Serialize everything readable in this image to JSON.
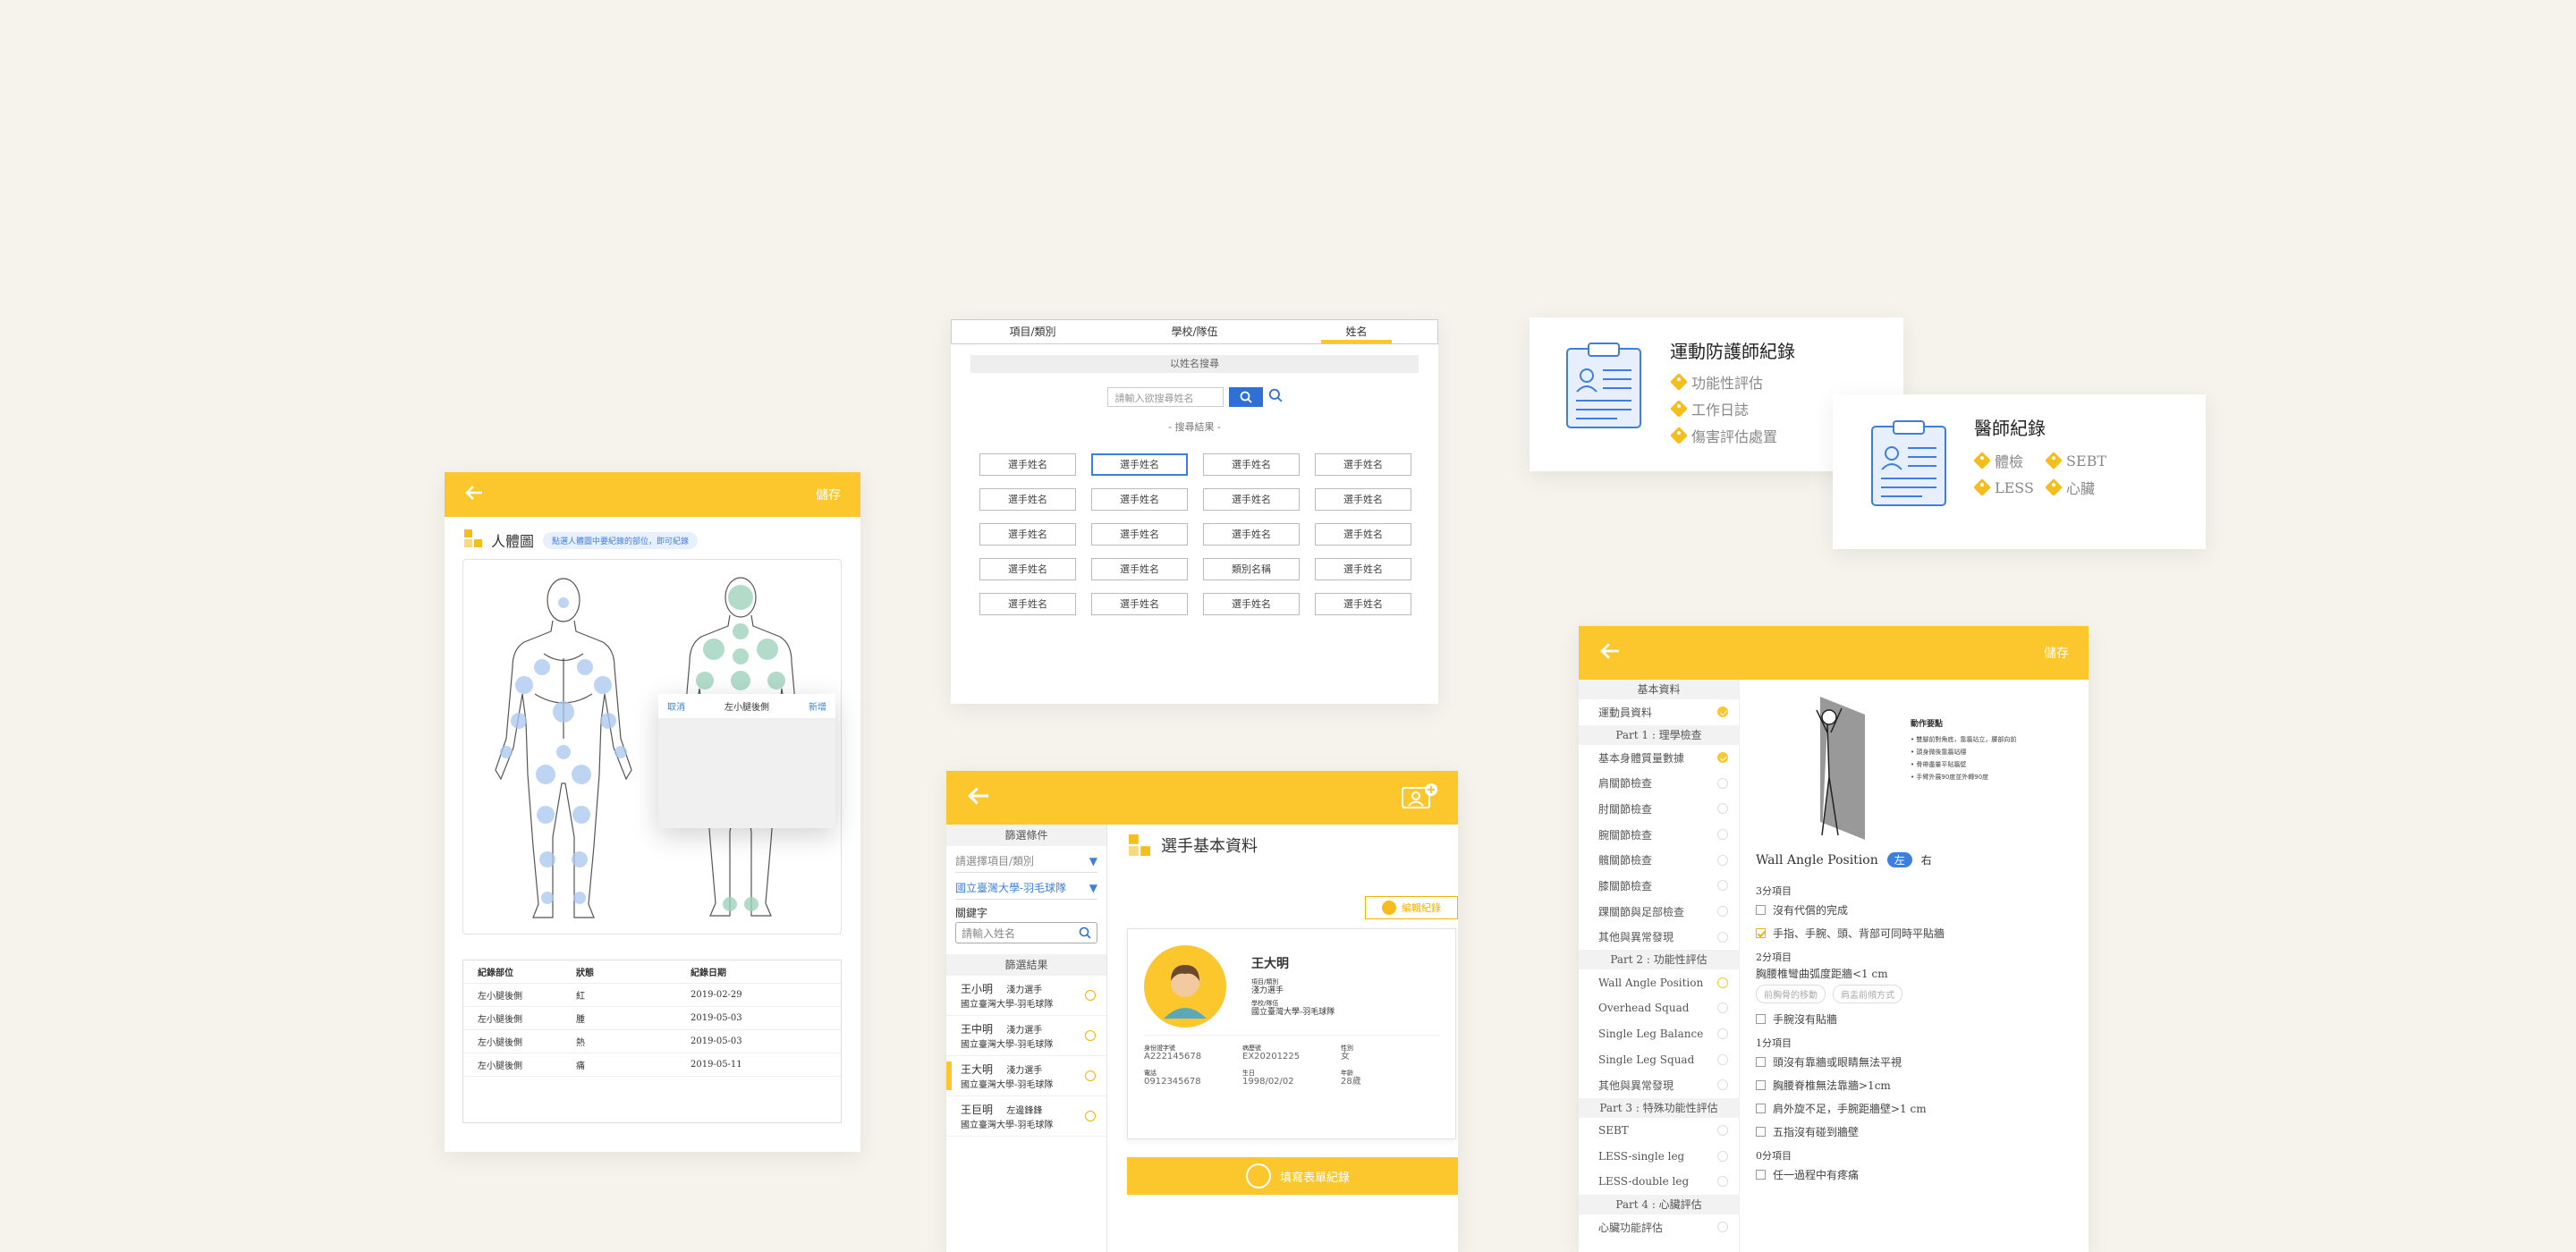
{
  "bodymap": {
    "save": "儲存",
    "title": "人體圖",
    "hint": "點選人體圖中要紀錄的部位，即可紀錄",
    "popup": {
      "cancel": "取消",
      "title": "左小腿後側",
      "add": "新增"
    },
    "table_headers": [
      "紀錄部位",
      "狀態",
      "紀錄日期"
    ],
    "rows": [
      [
        "左小腿後側",
        "紅",
        "2019-02-29"
      ],
      [
        "左小腿後側",
        "腫",
        "2019-05-03"
      ],
      [
        "左小腿後側",
        "熱",
        "2019-05-03"
      ],
      [
        "左小腿後側",
        "痛",
        "2019-05-11"
      ]
    ]
  },
  "search": {
    "tabs": [
      "項目/類別",
      "學校/隊伍",
      "姓名"
    ],
    "section": "以姓名搜尋",
    "placeholder": "請輸入欲搜尋姓名",
    "results_label": "- 搜尋結果 -",
    "grid": [
      "選手姓名",
      "選手姓名",
      "選手姓名",
      "選手姓名",
      "選手姓名",
      "選手姓名",
      "選手姓名",
      "選手姓名",
      "選手姓名",
      "選手姓名",
      "選手姓名",
      "選手姓名",
      "選手姓名",
      "選手姓名",
      "類別名稱",
      "選手姓名",
      "選手姓名",
      "選手姓名",
      "選手姓名",
      "選手姓名"
    ]
  },
  "trainer": {
    "title": "運動防護師紀錄",
    "tags": [
      "功能性評估",
      "工作日誌",
      "傷害評估處置"
    ]
  },
  "doctor": {
    "title": "醫師紀錄",
    "tags": [
      "體檢",
      "SEBT",
      "LESS",
      "心臟"
    ]
  },
  "profile": {
    "filter_title": "篩選條件",
    "select_project": "請選擇項目/類別",
    "select_school": "國立臺灣大學-羽毛球隊",
    "keyword_label": "關鍵字",
    "keyword_placeholder": "請輸入姓名",
    "results_title": "篩選結果",
    "list": [
      {
        "name": "王小明",
        "role": "淺力選手",
        "school": "國立臺灣大學-羽毛球隊"
      },
      {
        "name": "王中明",
        "role": "淺力選手",
        "school": "國立臺灣大學-羽毛球隊"
      },
      {
        "name": "王大明",
        "role": "淺力選手",
        "school": "國立臺灣大學-羽毛球隊"
      },
      {
        "name": "王巨明",
        "role": "左邊鋒鋒",
        "school": "國立臺灣大學-羽毛球隊"
      }
    ],
    "heading": "選手基本資料",
    "edit": "編輯紀錄",
    "name": "王大明",
    "cat_label": "項目/類別",
    "cat_value": "淺力選手",
    "school_label": "學校/隊伍",
    "school_value": "國立臺灣大學-羽毛球隊",
    "id_label": "身份證字號",
    "id_value": "A222145678",
    "no_label": "病歷號",
    "no_value": "EX20201225",
    "sex_label": "性別",
    "sex_value": "女",
    "tel_label": "電話",
    "tel_value": "0912345678",
    "bd_label": "生日",
    "bd_value": "1998/02/02",
    "age_label": "年齡",
    "age_value": "28歲",
    "fill_button": "填寫表單紀錄"
  },
  "evaluate": {
    "save": "儲存",
    "sections": [
      {
        "title": "基本資料",
        "items": [
          {
            "label": "運動員資料",
            "state": "done"
          }
        ]
      },
      {
        "title": "Part 1 : 理學檢查",
        "items": [
          {
            "label": "基本身體質量數據",
            "state": "done"
          },
          {
            "label": "肩關節檢查",
            "state": "none"
          },
          {
            "label": "肘關節檢查",
            "state": "none"
          },
          {
            "label": "腕關節檢查",
            "state": "none"
          },
          {
            "label": "髖關節檢查",
            "state": "none"
          },
          {
            "label": "膝關節檢查",
            "state": "none"
          },
          {
            "label": "踝關節與足部檢查",
            "state": "none"
          },
          {
            "label": "其他與異常發現",
            "state": "none"
          }
        ]
      },
      {
        "title": "Part 2 : 功能性評估",
        "items": [
          {
            "label": "Wall Angle Position",
            "state": "cur"
          },
          {
            "label": "Overhead Squad",
            "state": "none"
          },
          {
            "label": "Single Leg Balance",
            "state": "none"
          },
          {
            "label": "Single Leg Squad",
            "state": "none"
          },
          {
            "label": "其他與異常發現",
            "state": "none"
          }
        ]
      },
      {
        "title": "Part 3 : 特殊功能性評估",
        "items": [
          {
            "label": "SEBT",
            "state": "none"
          },
          {
            "label": "LESS-single leg",
            "state": "none"
          },
          {
            "label": "LESS-double leg",
            "state": "none"
          }
        ]
      },
      {
        "title": "Part 4 : 心臟評估",
        "items": [
          {
            "label": "心臟功能評估",
            "state": "none"
          }
        ]
      }
    ],
    "key_title": "動作要點",
    "key_points": [
      "雙腳前對角底，靠牆站立，腰部向前",
      "頭身微後靠牆站穩",
      "骨帶盡量平貼牆壁",
      "手臂外展90度並外轉90度"
    ],
    "test_title": "Wall Angle Position",
    "left": "左",
    "right": "右",
    "s3": "3分項目",
    "s3_items": [
      {
        "t": "沒有代償的完成",
        "on": false
      },
      {
        "t": "手指、手腕、頭、背部可同時平貼牆",
        "on": true
      }
    ],
    "s2": "2分項目",
    "s2_desc": "胸腰椎彎曲弧度距牆<1 cm",
    "s2_chips": [
      "前胸骨的移動",
      "肩盂前傾方式"
    ],
    "s2_items": [
      {
        "t": "手腕沒有貼牆",
        "on": false
      }
    ],
    "s1": "1分項目",
    "s1_items": [
      {
        "t": "頭沒有靠牆或眼睛無法平視",
        "on": false
      },
      {
        "t": "胸腰脊椎無法靠牆>1cm",
        "on": false
      },
      {
        "t": "肩外旋不足，手腕距牆壁>1 cm",
        "on": false
      },
      {
        "t": "五指沒有碰到牆壁",
        "on": false
      }
    ],
    "s0": "0分項目",
    "s0_items": [
      {
        "t": "任一過程中有疼痛",
        "on": false
      }
    ]
  }
}
